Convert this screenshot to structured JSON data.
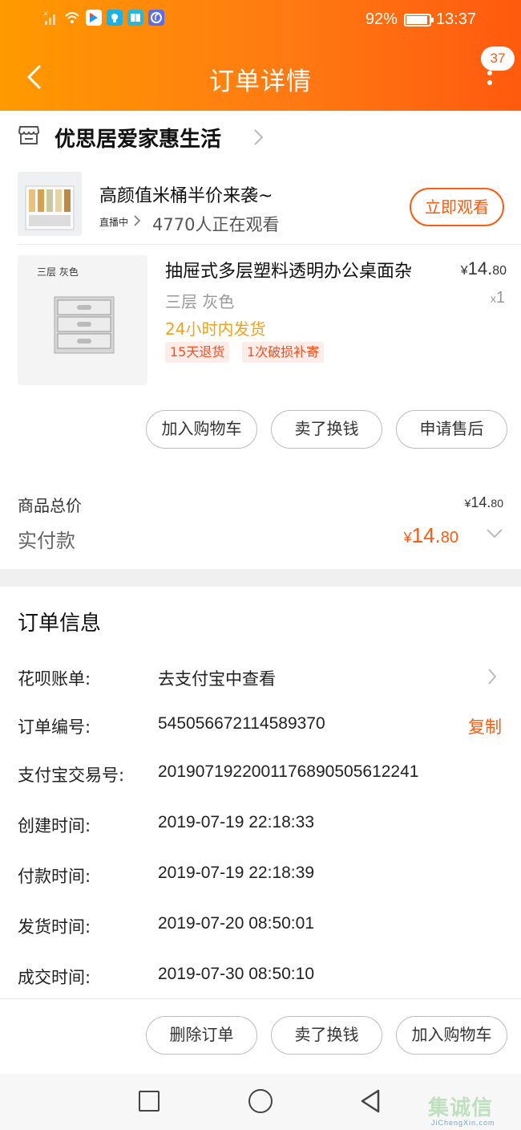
{
  "status_bar": {
    "battery": "92%",
    "time": "13:37"
  },
  "nav": {
    "title": "订单详情",
    "badge_count": "37"
  },
  "store": {
    "name": "优思居爱家惠生活"
  },
  "live": {
    "title": "高颜值米桶半价来袭~",
    "tag": "直播中",
    "viewers": "4770人正在观看",
    "watch_button": "立即观看"
  },
  "product": {
    "image_label": "三层 灰色",
    "title": "抽屉式多层塑料透明办公桌面杂",
    "price_symbol": "¥",
    "price_int": "14.",
    "price_dec": "80",
    "spec": "三层 灰色",
    "qty_prefix": "x",
    "qty": "1",
    "shipping": "24小时内发货",
    "tags": [
      "15天退货",
      "1次破损补寄"
    ]
  },
  "product_actions": [
    "加入购物车",
    "卖了换钱",
    "申请售后"
  ],
  "totals": {
    "goods_label": "商品总价",
    "goods_symbol": "¥",
    "goods_int": "14.",
    "goods_dec": "80",
    "paid_label": "实付款",
    "paid_symbol": "¥",
    "paid_int": "14.",
    "paid_dec": "80"
  },
  "order_info": {
    "title": "订单信息",
    "rows": [
      {
        "label": "花呗账单:",
        "value": "去支付宝中查看"
      },
      {
        "label": "订单编号:",
        "value": "545056672114589370"
      },
      {
        "label": "支付宝交易号:",
        "value": "2019071922001176890505612241"
      },
      {
        "label": "创建时间:",
        "value": "2019-07-19 22:18:33"
      },
      {
        "label": "付款时间:",
        "value": "2019-07-19 22:18:39"
      },
      {
        "label": "发货时间:",
        "value": "2019-07-20 08:50:01"
      },
      {
        "label": "成交时间:",
        "value": "2019-07-30 08:50:10"
      }
    ],
    "copy_label": "复制"
  },
  "bottom_actions": [
    "删除订单",
    "卖了换钱",
    "加入购物车"
  ],
  "watermark": {
    "cn": "集诚信",
    "en": "JiChengXin.com"
  },
  "colors": {
    "accent": "#ff5a0e",
    "header_start": "#ff9a00",
    "header_end": "#ff5a0e",
    "shipping": "#f0a31d"
  }
}
